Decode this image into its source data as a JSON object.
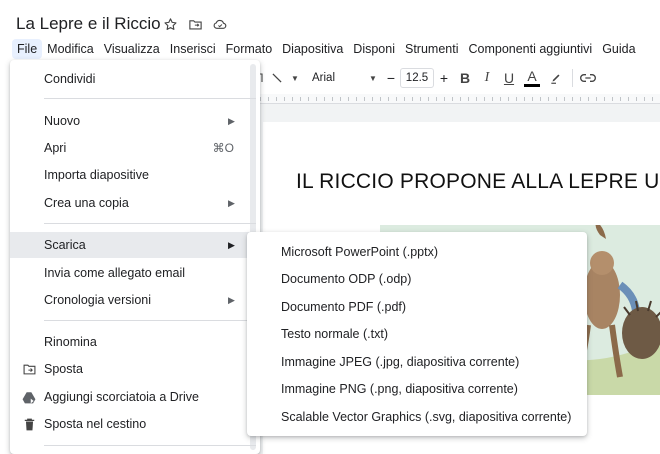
{
  "title_bar": {
    "doc_title": "La Lepre e il Riccio",
    "icons": [
      "star-icon",
      "move-to-folder-icon",
      "cloud-status-icon"
    ]
  },
  "menubar": {
    "items": [
      "File",
      "Modifica",
      "Visualizza",
      "Inserisci",
      "Formato",
      "Diapositiva",
      "Disponi",
      "Strumenti",
      "Componenti aggiuntivi",
      "Guida"
    ],
    "active": "File"
  },
  "toolbar": {
    "font": "Arial",
    "font_size": "12.5",
    "minus": "−",
    "plus": "+",
    "bold": "B",
    "italic": "I",
    "underline": "U",
    "text_color": "A"
  },
  "slide": {
    "title": "IL RICCIO PROPONE ALLA LEPRE U"
  },
  "file_menu": {
    "share": "Condividi",
    "new": "Nuovo",
    "open": "Apri",
    "open_shortcut": "⌘O",
    "import": "Importa diapositive",
    "copy": "Crea una copia",
    "download": "Scarica",
    "email": "Invia come allegato email",
    "history": "Cronologia versioni",
    "rename": "Rinomina",
    "move": "Sposta",
    "shortcut": "Aggiungi scorciatoia a Drive",
    "trash": "Sposta nel cestino"
  },
  "download_menu": {
    "items": [
      "Microsoft PowerPoint (.pptx)",
      "Documento ODP (.odp)",
      "Documento PDF (.pdf)",
      "Testo normale (.txt)",
      "Immagine JPEG (.jpg, diapositiva corrente)",
      "Immagine PNG (.png, diapositiva corrente)",
      "Scalable Vector Graphics (.svg, diapositiva corrente)"
    ]
  },
  "colors": {
    "menu_active_bg": "#e8f0fe",
    "item_highlight_bg": "#e8eaed",
    "text": "#202124"
  }
}
